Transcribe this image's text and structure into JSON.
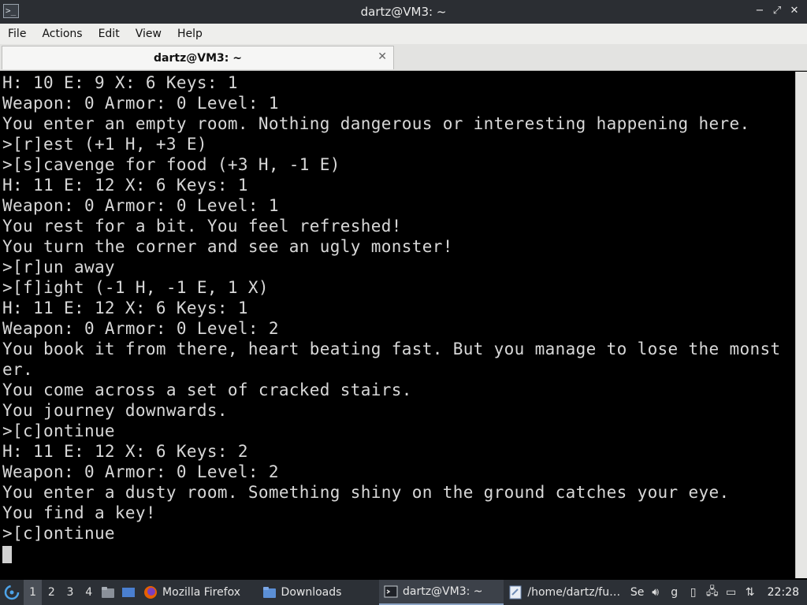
{
  "window": {
    "title": "dartz@VM3: ~",
    "buttons": [
      "−",
      "⤢",
      "✕"
    ]
  },
  "menu": [
    "File",
    "Actions",
    "Edit",
    "View",
    "Help"
  ],
  "tab": {
    "label": "dartz@VM3: ~",
    "close": "✕"
  },
  "terminal": {
    "lines": [
      "H: 10 E: 9 X: 6 Keys: 1",
      "Weapon: 0 Armor: 0 Level: 1",
      "You enter an empty room. Nothing dangerous or interesting happening here.",
      ">[r]est (+1 H, +3 E)",
      ">[s]cavenge for food (+3 H, -1 E)",
      "H: 11 E: 12 X: 6 Keys: 1",
      "Weapon: 0 Armor: 0 Level: 1",
      "You rest for a bit. You feel refreshed!",
      "You turn the corner and see an ugly monster!",
      ">[r]un away",
      ">[f]ight (-1 H, -1 E, 1 X)",
      "H: 11 E: 12 X: 6 Keys: 1",
      "Weapon: 0 Armor: 0 Level: 2",
      "You book it from there, heart beating fast. But you manage to lose the monst",
      "er.",
      "You come across a set of cracked stairs.",
      "You journey downwards.",
      ">[c]ontinue",
      "H: 11 E: 12 X: 6 Keys: 2",
      "Weapon: 0 Armor: 0 Level: 2",
      "You enter a dusty room. Something shiny on the ground catches your eye.",
      "You find a key!",
      ">[c]ontinue"
    ]
  },
  "taskbar": {
    "workspaces": [
      "1",
      "2",
      "3",
      "4"
    ],
    "tasks": [
      {
        "label": "Mozilla Firefox",
        "icon": "firefox-icon",
        "color": "#e66000"
      },
      {
        "label": "Downloads",
        "icon": "folder-icon",
        "color": "#5b8fd6"
      },
      {
        "label": "dartz@VM3: ~",
        "icon": "terminal-icon",
        "color": "#1f2228"
      },
      {
        "label": "/home/dartz/fu…",
        "icon": "text-editor-icon",
        "color": "#6f8cb5"
      },
      {
        "label": "Se",
        "icon": "settings-icon",
        "color": "#888888"
      }
    ],
    "tray_g": "g",
    "clock": "22:28"
  }
}
